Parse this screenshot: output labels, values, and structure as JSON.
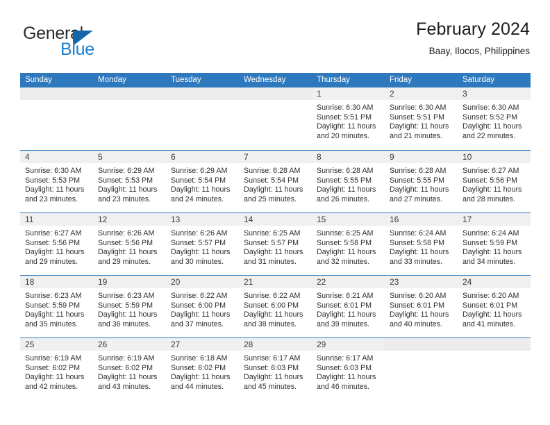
{
  "brand": {
    "name_top": "General",
    "name_bottom": "Blue",
    "accent_color": "#1b7fd0",
    "flag_color": "#1567ab",
    "logo_icon": "triangle-flag-icon"
  },
  "header": {
    "title": "February 2024",
    "subtitle": "Baay, Ilocos, Philippines"
  },
  "theme": {
    "header_row_bg": "#2e79bd",
    "header_row_text": "#ffffff",
    "date_bar_bg": "#f0f0f0",
    "grid_line": "#2e79bd"
  },
  "weekdays": [
    "Sunday",
    "Monday",
    "Tuesday",
    "Wednesday",
    "Thursday",
    "Friday",
    "Saturday"
  ],
  "labels": {
    "sunrise": "Sunrise:",
    "sunset": "Sunset:",
    "daylight": "Daylight:"
  },
  "weeks": [
    [
      {
        "day": ""
      },
      {
        "day": ""
      },
      {
        "day": ""
      },
      {
        "day": ""
      },
      {
        "day": "1",
        "sunrise": "Sunrise: 6:30 AM",
        "sunset": "Sunset: 5:51 PM",
        "daylight_l1": "Daylight: 11 hours",
        "daylight_l2": "and 20 minutes."
      },
      {
        "day": "2",
        "sunrise": "Sunrise: 6:30 AM",
        "sunset": "Sunset: 5:51 PM",
        "daylight_l1": "Daylight: 11 hours",
        "daylight_l2": "and 21 minutes."
      },
      {
        "day": "3",
        "sunrise": "Sunrise: 6:30 AM",
        "sunset": "Sunset: 5:52 PM",
        "daylight_l1": "Daylight: 11 hours",
        "daylight_l2": "and 22 minutes."
      }
    ],
    [
      {
        "day": "4",
        "sunrise": "Sunrise: 6:30 AM",
        "sunset": "Sunset: 5:53 PM",
        "daylight_l1": "Daylight: 11 hours",
        "daylight_l2": "and 23 minutes."
      },
      {
        "day": "5",
        "sunrise": "Sunrise: 6:29 AM",
        "sunset": "Sunset: 5:53 PM",
        "daylight_l1": "Daylight: 11 hours",
        "daylight_l2": "and 23 minutes."
      },
      {
        "day": "6",
        "sunrise": "Sunrise: 6:29 AM",
        "sunset": "Sunset: 5:54 PM",
        "daylight_l1": "Daylight: 11 hours",
        "daylight_l2": "and 24 minutes."
      },
      {
        "day": "7",
        "sunrise": "Sunrise: 6:28 AM",
        "sunset": "Sunset: 5:54 PM",
        "daylight_l1": "Daylight: 11 hours",
        "daylight_l2": "and 25 minutes."
      },
      {
        "day": "8",
        "sunrise": "Sunrise: 6:28 AM",
        "sunset": "Sunset: 5:55 PM",
        "daylight_l1": "Daylight: 11 hours",
        "daylight_l2": "and 26 minutes."
      },
      {
        "day": "9",
        "sunrise": "Sunrise: 6:28 AM",
        "sunset": "Sunset: 5:55 PM",
        "daylight_l1": "Daylight: 11 hours",
        "daylight_l2": "and 27 minutes."
      },
      {
        "day": "10",
        "sunrise": "Sunrise: 6:27 AM",
        "sunset": "Sunset: 5:56 PM",
        "daylight_l1": "Daylight: 11 hours",
        "daylight_l2": "and 28 minutes."
      }
    ],
    [
      {
        "day": "11",
        "sunrise": "Sunrise: 6:27 AM",
        "sunset": "Sunset: 5:56 PM",
        "daylight_l1": "Daylight: 11 hours",
        "daylight_l2": "and 29 minutes."
      },
      {
        "day": "12",
        "sunrise": "Sunrise: 6:26 AM",
        "sunset": "Sunset: 5:56 PM",
        "daylight_l1": "Daylight: 11 hours",
        "daylight_l2": "and 29 minutes."
      },
      {
        "day": "13",
        "sunrise": "Sunrise: 6:26 AM",
        "sunset": "Sunset: 5:57 PM",
        "daylight_l1": "Daylight: 11 hours",
        "daylight_l2": "and 30 minutes."
      },
      {
        "day": "14",
        "sunrise": "Sunrise: 6:25 AM",
        "sunset": "Sunset: 5:57 PM",
        "daylight_l1": "Daylight: 11 hours",
        "daylight_l2": "and 31 minutes."
      },
      {
        "day": "15",
        "sunrise": "Sunrise: 6:25 AM",
        "sunset": "Sunset: 5:58 PM",
        "daylight_l1": "Daylight: 11 hours",
        "daylight_l2": "and 32 minutes."
      },
      {
        "day": "16",
        "sunrise": "Sunrise: 6:24 AM",
        "sunset": "Sunset: 5:58 PM",
        "daylight_l1": "Daylight: 11 hours",
        "daylight_l2": "and 33 minutes."
      },
      {
        "day": "17",
        "sunrise": "Sunrise: 6:24 AM",
        "sunset": "Sunset: 5:59 PM",
        "daylight_l1": "Daylight: 11 hours",
        "daylight_l2": "and 34 minutes."
      }
    ],
    [
      {
        "day": "18",
        "sunrise": "Sunrise: 6:23 AM",
        "sunset": "Sunset: 5:59 PM",
        "daylight_l1": "Daylight: 11 hours",
        "daylight_l2": "and 35 minutes."
      },
      {
        "day": "19",
        "sunrise": "Sunrise: 6:23 AM",
        "sunset": "Sunset: 5:59 PM",
        "daylight_l1": "Daylight: 11 hours",
        "daylight_l2": "and 36 minutes."
      },
      {
        "day": "20",
        "sunrise": "Sunrise: 6:22 AM",
        "sunset": "Sunset: 6:00 PM",
        "daylight_l1": "Daylight: 11 hours",
        "daylight_l2": "and 37 minutes."
      },
      {
        "day": "21",
        "sunrise": "Sunrise: 6:22 AM",
        "sunset": "Sunset: 6:00 PM",
        "daylight_l1": "Daylight: 11 hours",
        "daylight_l2": "and 38 minutes."
      },
      {
        "day": "22",
        "sunrise": "Sunrise: 6:21 AM",
        "sunset": "Sunset: 6:01 PM",
        "daylight_l1": "Daylight: 11 hours",
        "daylight_l2": "and 39 minutes."
      },
      {
        "day": "23",
        "sunrise": "Sunrise: 6:20 AM",
        "sunset": "Sunset: 6:01 PM",
        "daylight_l1": "Daylight: 11 hours",
        "daylight_l2": "and 40 minutes."
      },
      {
        "day": "24",
        "sunrise": "Sunrise: 6:20 AM",
        "sunset": "Sunset: 6:01 PM",
        "daylight_l1": "Daylight: 11 hours",
        "daylight_l2": "and 41 minutes."
      }
    ],
    [
      {
        "day": "25",
        "sunrise": "Sunrise: 6:19 AM",
        "sunset": "Sunset: 6:02 PM",
        "daylight_l1": "Daylight: 11 hours",
        "daylight_l2": "and 42 minutes."
      },
      {
        "day": "26",
        "sunrise": "Sunrise: 6:19 AM",
        "sunset": "Sunset: 6:02 PM",
        "daylight_l1": "Daylight: 11 hours",
        "daylight_l2": "and 43 minutes."
      },
      {
        "day": "27",
        "sunrise": "Sunrise: 6:18 AM",
        "sunset": "Sunset: 6:02 PM",
        "daylight_l1": "Daylight: 11 hours",
        "daylight_l2": "and 44 minutes."
      },
      {
        "day": "28",
        "sunrise": "Sunrise: 6:17 AM",
        "sunset": "Sunset: 6:03 PM",
        "daylight_l1": "Daylight: 11 hours",
        "daylight_l2": "and 45 minutes."
      },
      {
        "day": "29",
        "sunrise": "Sunrise: 6:17 AM",
        "sunset": "Sunset: 6:03 PM",
        "daylight_l1": "Daylight: 11 hours",
        "daylight_l2": "and 46 minutes."
      },
      {
        "day": ""
      },
      {
        "day": ""
      }
    ]
  ]
}
